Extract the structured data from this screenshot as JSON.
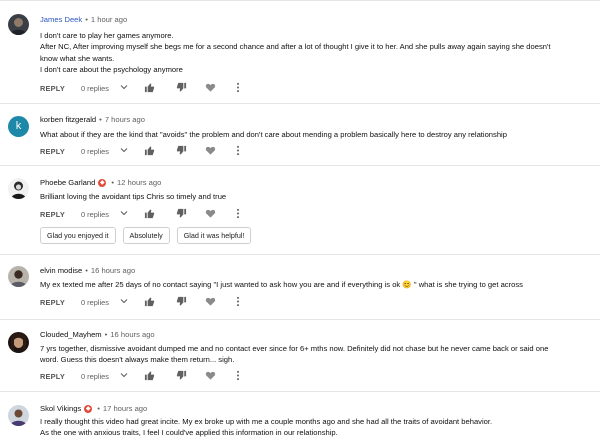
{
  "comments": [
    {
      "author": "James Deek",
      "time": "1 hour ago",
      "lines": [
        "I don't care to play her games anymore.",
        "After NC, After improving myself she begs me for a second chance and after a lot of thought I give it to her. And she pulls away again saying she doesn't",
        "know what she wants.",
        "I don't care about the psychology anymore"
      ],
      "reply_label": "REPLY",
      "replies_label": "0 replies"
    },
    {
      "author": "korben fitzgerald",
      "avatar_letter": "k",
      "time": "7 hours ago",
      "lines": [
        "What about if they are the kind that \"avoids\" the problem and don't care about mending a problem basically here to destroy any relationship"
      ],
      "reply_label": "REPLY",
      "replies_label": "0 replies"
    },
    {
      "author": "Phoebe Garland",
      "time": "12 hours ago",
      "lines": [
        "Brilliant loving the avoidant tips Chris so timely and true"
      ],
      "reply_label": "REPLY",
      "replies_label": "0 replies",
      "suggestions": [
        "Glad you enjoyed it",
        "Absolutely",
        "Glad it was helpful!"
      ]
    },
    {
      "author": "elvin modise",
      "time": "16 hours ago",
      "lines": [
        "My ex texted me after 25 days of no contact saying \"I just wanted to ask how you are and if everything is ok 😊 \" what is she trying to get across"
      ],
      "reply_label": "REPLY",
      "replies_label": "0 replies"
    },
    {
      "author": "Clouded_Mayhem",
      "time": "16 hours ago",
      "lines": [
        "7 yrs together, dismissive avoidant dumped me and no contact ever since for 6+ mths now. Definitely did not chase but he never came back or said one",
        "word. Guess this doesn't always make them return... sigh."
      ],
      "reply_label": "REPLY",
      "replies_label": "0 replies"
    },
    {
      "author": "Skol Vikings",
      "time": "17 hours ago",
      "lines": [
        "I really thought this video had great incite. My ex broke up with me a couple months ago and she had all the traits of avoidant behavior.",
        "As the one with anxious traits, I feel I could've applied this information in our relationship."
      ]
    }
  ],
  "colors": {
    "author_highlight": "#2d57c0",
    "badge": "#e24b3c",
    "avatar_k": "#1e88a8"
  },
  "icons": [
    "thumb-up-icon",
    "thumb-down-icon",
    "heart-icon",
    "more-vert-icon",
    "chevron-down-icon"
  ]
}
